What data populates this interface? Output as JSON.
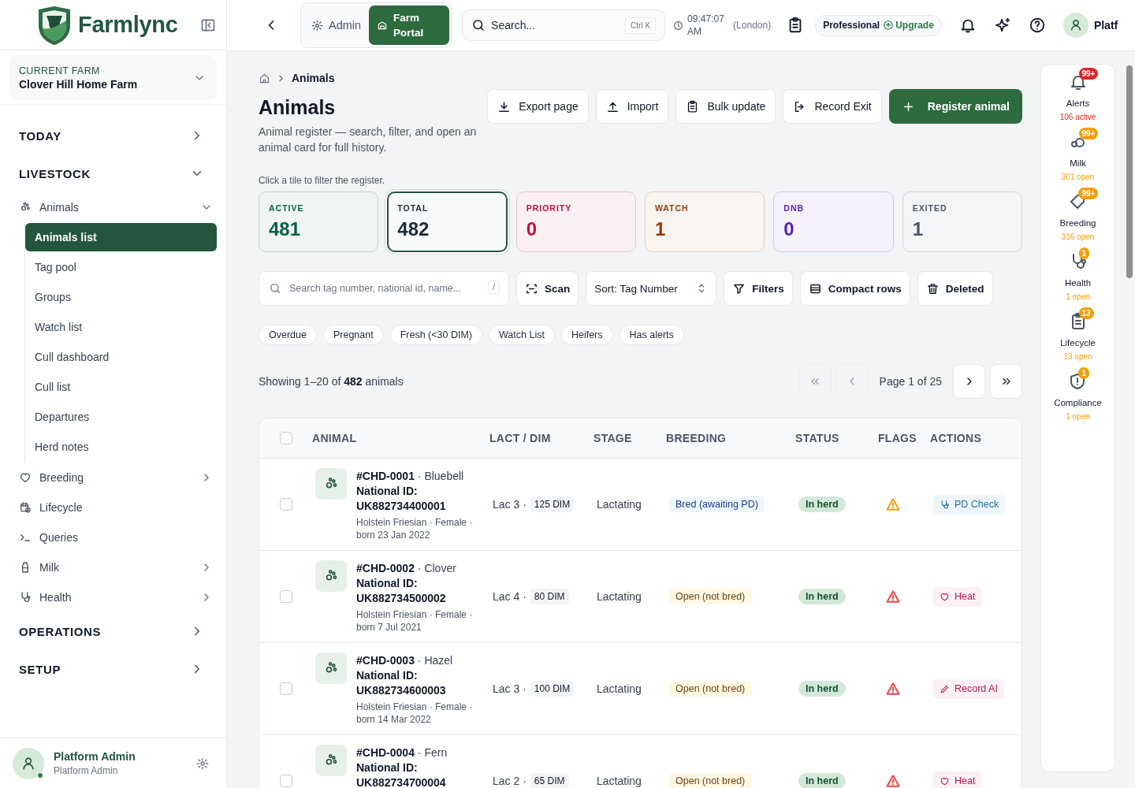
{
  "sidebar": {
    "brand": "Farmlync",
    "current_farm": {
      "label": "CURRENT FARM",
      "name": "Clover Hill Home Farm"
    },
    "sections": [
      {
        "label": "TODAY",
        "expanded": false
      },
      {
        "label": "LIVESTOCK",
        "expanded": true,
        "items": [
          {
            "label": "Animals",
            "expanded": true,
            "children": [
              {
                "label": "Animals list",
                "selected": true
              },
              {
                "label": "Tag pool",
                "selected": false
              },
              {
                "label": "Groups",
                "selected": false
              },
              {
                "label": "Watch list",
                "selected": false
              },
              {
                "label": "Cull dashboard",
                "selected": false
              },
              {
                "label": "Cull list",
                "selected": false
              },
              {
                "label": "Departures",
                "selected": false
              },
              {
                "label": "Herd notes",
                "selected": false
              }
            ]
          },
          {
            "label": "Breeding",
            "expanded": false
          },
          {
            "label": "Lifecycle"
          },
          {
            "label": "Queries"
          },
          {
            "label": "Milk",
            "expanded": false
          },
          {
            "label": "Health",
            "expanded": false
          }
        ]
      },
      {
        "label": "OPERATIONS",
        "expanded": false
      },
      {
        "label": "SETUP",
        "expanded": false
      }
    ],
    "user": {
      "name": "Platform Admin",
      "role": "Platform Admin",
      "online": true
    }
  },
  "topbar": {
    "portals": [
      {
        "label": "Admin",
        "selected": false
      },
      {
        "label": "Farm Portal",
        "selected": true
      }
    ],
    "search": {
      "placeholder": "Search...",
      "shortcut": "Ctrl K"
    },
    "clock": {
      "time": "09:47:07 AM",
      "zone": "(London)"
    },
    "plan": {
      "name": "Professional",
      "action": "Upgrade"
    },
    "user_name": "Platf"
  },
  "page": {
    "breadcrumb": [
      "Animals"
    ],
    "title": "Animals",
    "subtitle": "Animal register — search, filter, and open an animal card for full history.",
    "actions": [
      {
        "label": "Export page",
        "kind": "secondary"
      },
      {
        "label": "Import",
        "kind": "secondary"
      },
      {
        "label": "Bulk update",
        "kind": "secondary"
      },
      {
        "label": "Record Exit",
        "kind": "secondary"
      },
      {
        "label": "Register animal",
        "kind": "primary"
      }
    ],
    "hint": "Click a tile to filter the register.",
    "tiles": [
      {
        "label": "ACTIVE",
        "value": "481",
        "color": "#065f46",
        "selected": false
      },
      {
        "label": "TOTAL",
        "value": "482",
        "color": "#1f2937",
        "selected": true
      },
      {
        "label": "PRIORITY",
        "value": "0",
        "color": "#be123c",
        "selected": false
      },
      {
        "label": "WATCH",
        "value": "1",
        "color": "#92400e",
        "selected": false
      },
      {
        "label": "DNB",
        "value": "0",
        "color": "#5b21b6",
        "selected": false
      },
      {
        "label": "EXITED",
        "value": "1",
        "color": "#4b5563",
        "selected": false
      }
    ],
    "search": {
      "placeholder": "Search tag number, national id, name...",
      "shortcut": "/"
    },
    "tools": [
      {
        "label": "Scan",
        "kind": "button"
      },
      {
        "label": "Sort: Tag Number",
        "kind": "select"
      },
      {
        "label": "Filters",
        "kind": "button"
      },
      {
        "label": "Compact rows",
        "kind": "button"
      },
      {
        "label": "Deleted",
        "kind": "button"
      }
    ],
    "chips": [
      {
        "label": "Overdue",
        "selected": false
      },
      {
        "label": "Pregnant",
        "selected": false
      },
      {
        "label": "Fresh (<30 DIM)",
        "selected": false
      },
      {
        "label": "Watch List",
        "selected": false
      },
      {
        "label": "Heifers",
        "selected": false
      },
      {
        "label": "Has alerts",
        "selected": false
      }
    ],
    "summary": "Showing 1–20 of **482** animals",
    "pagination": {
      "page_label": "Page 1 of 25",
      "first_disabled": true,
      "prev_disabled": true,
      "next_disabled": false,
      "last_disabled": false
    },
    "table": {
      "select_all": false,
      "columns": [
        "ANIMAL",
        "LACT / DIM",
        "STAGE",
        "BREEDING",
        "STATUS",
        "FLAGS",
        "ACTIONS"
      ],
      "rows": [
        {
          "selected": false,
          "title": "**#CHD-0001** · Bluebell",
          "national_id": "National ID: UK882734400001",
          "details": "Holstein Friesian · Female · born 23 Jan 2022",
          "lact": "Lac 3 ·",
          "dim": "125 DIM",
          "stage": "Lactating",
          "breeding": {
            "label": "Bred (awaiting PD)",
            "kind": "bred"
          },
          "status": {
            "label": "In herd",
            "kind": "in_herd"
          },
          "flag": {
            "color": "#f59e0b"
          },
          "action": {
            "label": "PD Check",
            "kind": "pd_check"
          }
        },
        {
          "selected": false,
          "title": "**#CHD-0002** · Clover",
          "national_id": "National ID: UK882734500002",
          "details": "Holstein Friesian · Female · born 7 Jul 2021",
          "lact": "Lac 4 ·",
          "dim": "80 DIM",
          "stage": "Lactating",
          "breeding": {
            "label": "Open (not bred)",
            "kind": "open"
          },
          "status": {
            "label": "In herd",
            "kind": "in_herd"
          },
          "flag": {
            "color": "#ef4444"
          },
          "action": {
            "label": "Heat",
            "kind": "heat"
          }
        },
        {
          "selected": false,
          "title": "**#CHD-0003** · Hazel",
          "national_id": "National ID: UK882734600003",
          "details": "Holstein Friesian · Female · born 14 Mar 2022",
          "lact": "Lac 3 ·",
          "dim": "100 DIM",
          "stage": "Lactating",
          "breeding": {
            "label": "Open (not bred)",
            "kind": "open"
          },
          "status": {
            "label": "In herd",
            "kind": "in_herd"
          },
          "flag": {
            "color": "#ef4444"
          },
          "action": {
            "label": "Record AI",
            "kind": "record_ai"
          }
        },
        {
          "selected": false,
          "title": "**#CHD-0004** · Fern",
          "national_id": "National ID: UK882734700004",
          "lact": "Lac 2 ·",
          "dim": "65 DIM",
          "stage": "Lactating",
          "breeding": {
            "label": "Open (not bred)",
            "kind": "open"
          },
          "status": {
            "label": "In herd",
            "kind": "in_herd"
          },
          "flag": {
            "color": "#ef4444"
          },
          "action": {
            "label": "Heat",
            "kind": "heat"
          }
        }
      ]
    }
  },
  "quick_panel": [
    {
      "label": "Alerts",
      "badge": "99+",
      "summary": "106 active",
      "color": "#dc2626"
    },
    {
      "label": "Milk",
      "badge": "99+",
      "summary": "301 open",
      "color": "#f59e0b"
    },
    {
      "label": "Breeding",
      "badge": "99+",
      "summary": "316 open",
      "color": "#f59e0b"
    },
    {
      "label": "Health",
      "badge": "1",
      "summary": "1 open",
      "color": "#f59e0b"
    },
    {
      "label": "Lifecycle",
      "badge": "13",
      "summary": "13 open",
      "color": "#f59e0b"
    },
    {
      "label": "Compliance",
      "badge": "1",
      "summary": "1 open",
      "color": "#f59e0b"
    }
  ]
}
